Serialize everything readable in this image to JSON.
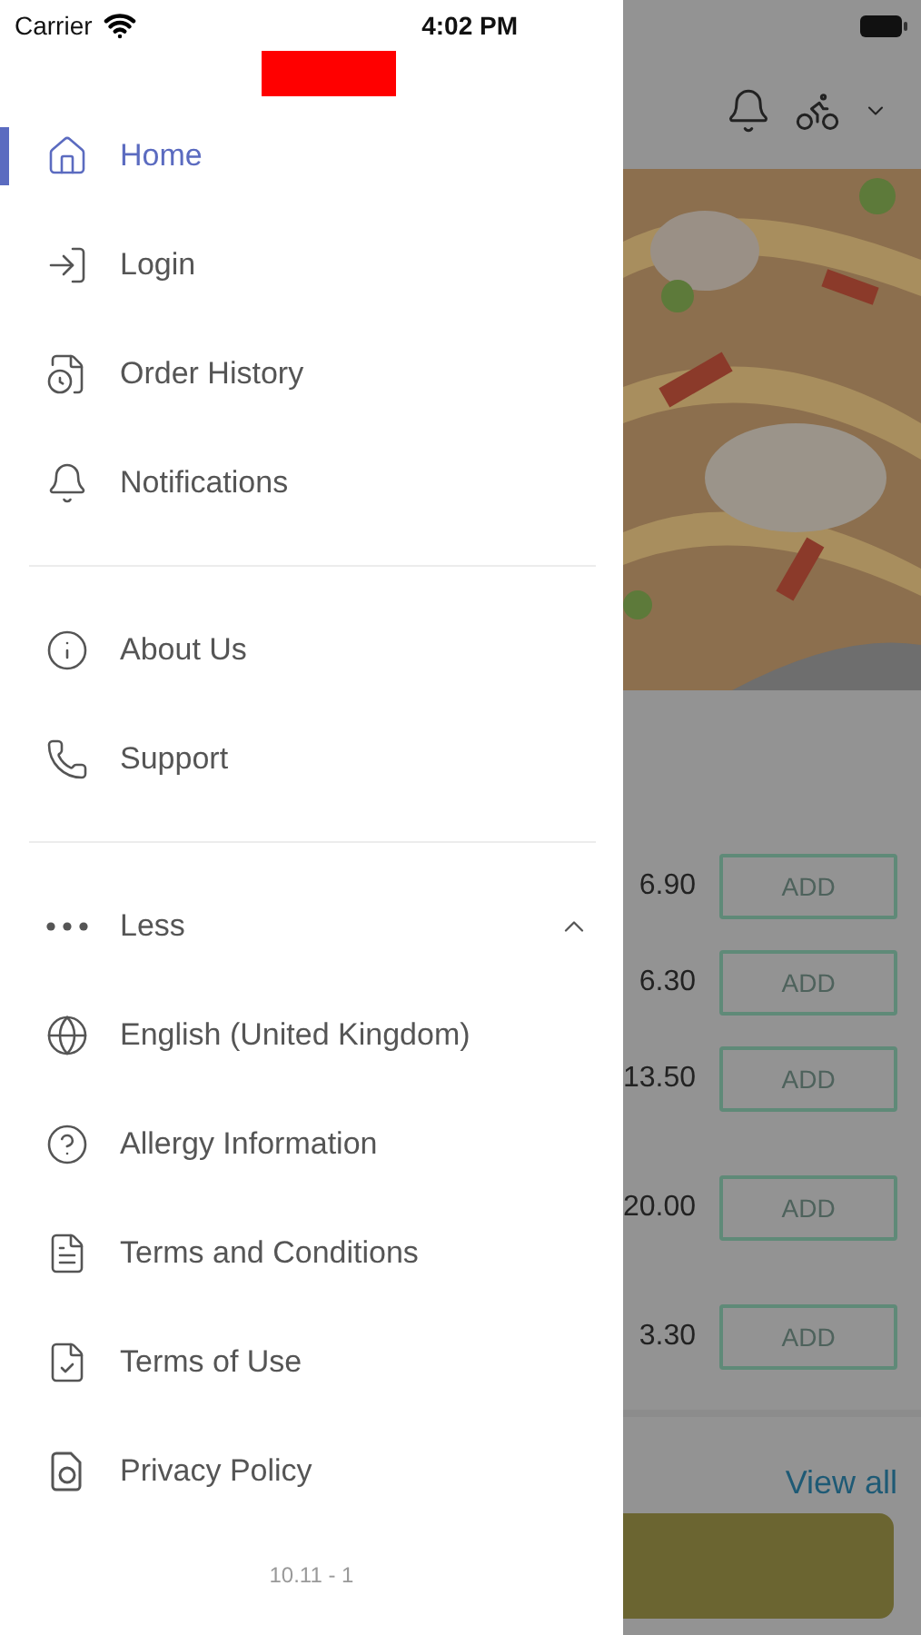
{
  "status_bar": {
    "carrier": "Carrier",
    "time": "4:02 PM"
  },
  "drawer": {
    "sections": [
      {
        "items": [
          {
            "label": "Home",
            "selected": true
          },
          {
            "label": "Login",
            "selected": false
          },
          {
            "label": "Order History",
            "selected": false
          },
          {
            "label": "Notifications",
            "selected": false
          }
        ]
      },
      {
        "items": [
          {
            "label": "About Us",
            "selected": false
          },
          {
            "label": "Support",
            "selected": false
          }
        ]
      }
    ],
    "more_toggle": {
      "label": "Less",
      "expanded": true
    },
    "more_items": [
      {
        "label": "English (United Kingdom)",
        "selected": false
      },
      {
        "label": "Allergy Information",
        "selected": false
      },
      {
        "label": "Terms and Conditions",
        "selected": false
      },
      {
        "label": "Terms of Use",
        "selected": false
      },
      {
        "label": "Privacy Policy",
        "selected": false
      }
    ],
    "version": "10.11 - 1"
  },
  "background": {
    "products": [
      {
        "price": "6.90",
        "button": "ADD"
      },
      {
        "price": "6.30",
        "button": "ADD"
      },
      {
        "price": "13.50",
        "button": "ADD"
      },
      {
        "price": "20.00",
        "button": "ADD"
      },
      {
        "price": "3.30",
        "button": "ADD"
      }
    ],
    "link": "View all"
  }
}
